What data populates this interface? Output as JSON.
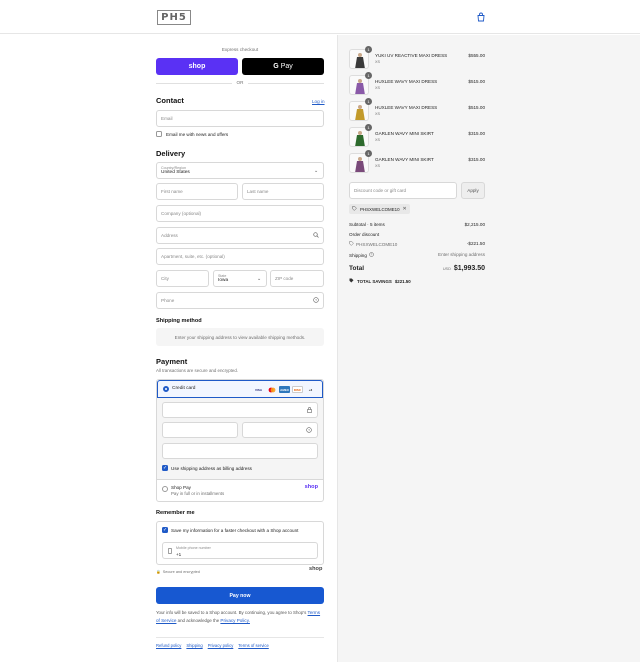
{
  "header": {
    "logo": "PH5",
    "cart_icon": "bag-icon"
  },
  "express": {
    "label": "Express checkout",
    "shop_label": "shop",
    "gpay_label": "Pay",
    "or": "OR"
  },
  "contact": {
    "title": "Contact",
    "login_link": "Log in",
    "email_placeholder": "Email",
    "news_label": "Email me with news and offers"
  },
  "delivery": {
    "title": "Delivery",
    "country_label": "Country/Region",
    "country_value": "United States",
    "first_name": "First name",
    "last_name": "Last name",
    "company": "Company (optional)",
    "address": "Address",
    "apartment": "Apartment, suite, etc. (optional)",
    "city": "City",
    "state_label": "State",
    "state_value": "Iowa",
    "zip": "ZIP code",
    "phone": "Phone"
  },
  "shipping": {
    "title": "Shipping method",
    "message": "Enter your shipping address to view available shipping methods."
  },
  "payment": {
    "title": "Payment",
    "subtitle": "All transactions are secure and encrypted.",
    "credit_card": "Credit card",
    "cards": [
      "VISA",
      "MC",
      "AMEX",
      "DISC",
      "+3"
    ],
    "billing_label": "Use shipping address as billing address",
    "shoppay_title": "Shop Pay",
    "shoppay_sub": "Pay in full or in installments",
    "shoppay_logo": "shop"
  },
  "remember": {
    "title": "Remember me",
    "save_label": "Save my information for a faster checkout with a Shop account",
    "mobile_label": "Mobile phone number",
    "mobile_value": "+1",
    "secure_label": "Secure and encrypted",
    "shop_logo": "shop"
  },
  "pay_now": "Pay now",
  "legal": {
    "text1": "Your info will be saved to a Shop account. By continuing, you agree to Shop's",
    "tos": "Terms of Service",
    "and": "and acknowledge the",
    "privacy": "Privacy Policy."
  },
  "footer": [
    "Refund policy",
    "Shipping",
    "Privacy policy",
    "Terms of service"
  ],
  "order": {
    "items": [
      {
        "name": "YUKI UV REACTIVE MAXI DRESS",
        "size": "XS",
        "price": "$555.00",
        "qty": "1",
        "color": "#3a3a3a"
      },
      {
        "name": "HUXLEE WAVY MAXI DRESS",
        "size": "XS",
        "price": "$515.00",
        "qty": "1",
        "color": "#8a5aa8"
      },
      {
        "name": "HUXLEE WAVY MAXI DRESS",
        "size": "XS",
        "price": "$515.00",
        "qty": "1",
        "color": "#c29a2a"
      },
      {
        "name": "GARLEN WAVY MINI SKIRT",
        "size": "XS",
        "price": "$315.00",
        "qty": "1",
        "color": "#2d6a2d"
      },
      {
        "name": "GARLEN WAVY MINI SKIRT",
        "size": "XS",
        "price": "$315.00",
        "qty": "1",
        "color": "#7a4a7a"
      }
    ],
    "discount_placeholder": "Discount code or gift card",
    "apply": "Apply",
    "applied_code": "PHSXWELCOME10",
    "subtotal_label": "Subtotal · 5 items",
    "subtotal_value": "$2,215.00",
    "order_discount_label": "Order discount",
    "discount_code": "PHSXWELCOME10",
    "discount_value": "-$221.50",
    "shipping_label": "Shipping",
    "shipping_value": "Enter shipping address",
    "total_label": "Total",
    "currency": "USD",
    "total_value": "$1,993.50",
    "savings_label": "TOTAL SAVINGS",
    "savings_value": "$221.50"
  }
}
